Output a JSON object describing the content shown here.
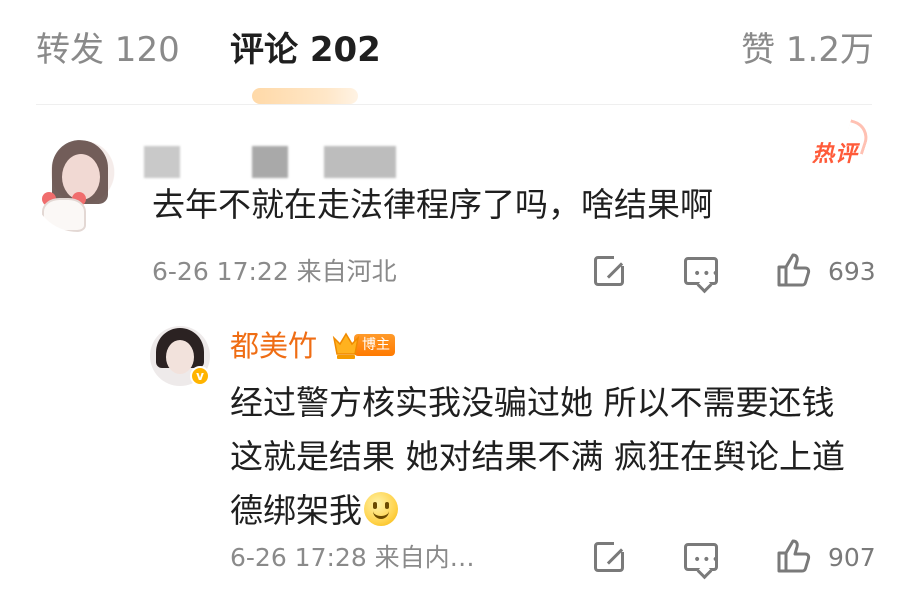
{
  "tabs": {
    "forward": "转发 120",
    "comments": "评论 202",
    "likes": "赞 1.2万"
  },
  "comment": {
    "hot_label": "热评",
    "text": "去年不就在走法律程序了吗，啥结果啊",
    "meta": "6-26 17:22 来自河北",
    "like_count": "693"
  },
  "reply": {
    "author": "都美竹",
    "badge": "博主",
    "text": "经过警方核实我没骗过她 所以不需要还钱 这就是结果 她对结果不满 疯狂在舆论上道德绑架我",
    "meta": "6-26 17:28 来自内…",
    "like_count": "907"
  },
  "icons": {
    "share": "share-icon",
    "reply": "reply-icon",
    "like": "thumbs-up-icon",
    "emoji": "smile-emoji-icon",
    "verified": "verified-badge-icon",
    "crown": "crown-icon"
  },
  "colors": {
    "accent_orange": "#ef6d14",
    "hot_red": "#ff5b3a",
    "meta_gray": "#8a8a8a"
  }
}
